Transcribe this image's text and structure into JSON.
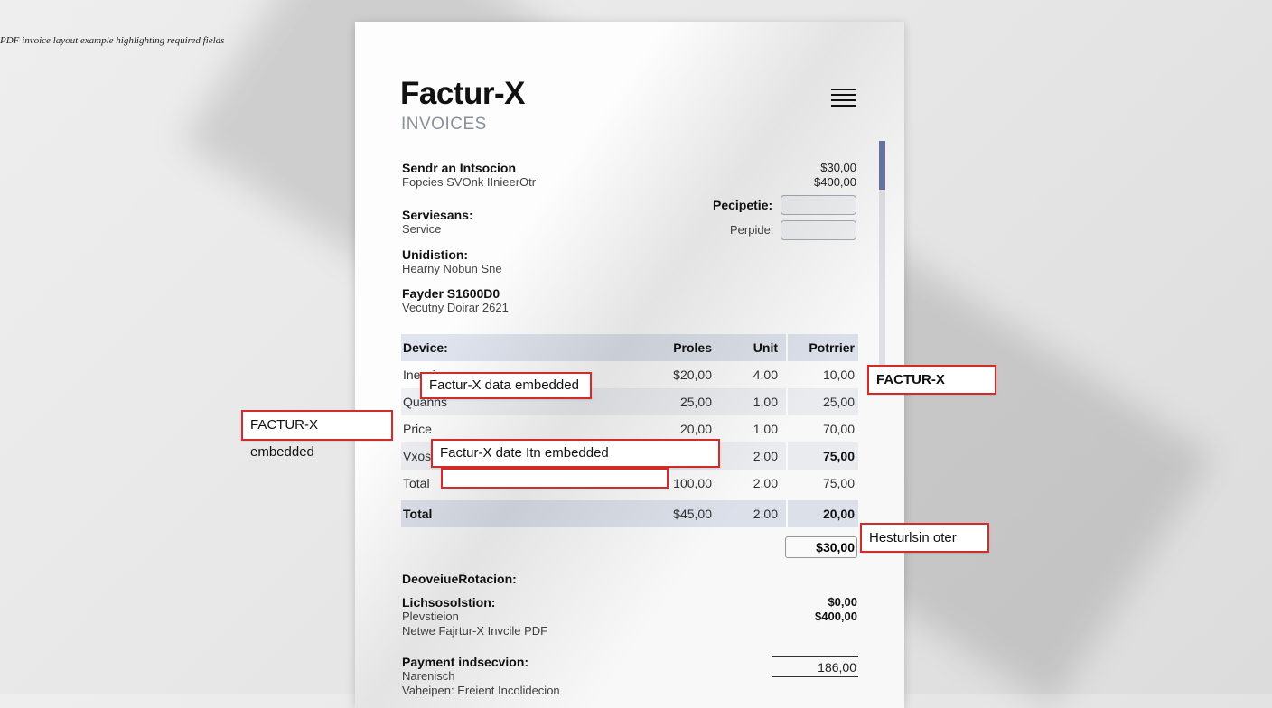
{
  "caption": "PDF invoice layout example highlighting required fields",
  "header": {
    "title": "Factur-X",
    "subtitle": "INVOICES",
    "menu_icon": "hamburger-menu-icon"
  },
  "sender": {
    "title": "Sendr an Intsocion",
    "line": "Fopcies SVOnk IInieerOtr"
  },
  "top_amounts": [
    "$30,00",
    "$400,00"
  ],
  "services": {
    "title": "Serviesans:",
    "line": "Service"
  },
  "distribution": {
    "title": "Unidistion:",
    "line": "Hearny Nobun Sne"
  },
  "payer": {
    "title": "Fayder S1600D0",
    "line": "Vecutny Doirar 2621"
  },
  "fields": {
    "recipient_label": "Pecipetie:",
    "perpide_label": "Perpide:"
  },
  "table": {
    "headers": [
      "Device:",
      "Proles",
      "Unit",
      "Potrrier"
    ],
    "rows": [
      [
        "Inerr ion",
        "$20,00",
        "4,00",
        "10,00"
      ],
      [
        "Quanns",
        "25,00",
        "1,00",
        "25,00"
      ],
      [
        "Price",
        "20,00",
        "1,00",
        "70,00"
      ],
      [
        "Vxos",
        "",
        "2,00",
        "75,00"
      ],
      [
        "Total",
        "100,00",
        "2,00",
        "75,00"
      ]
    ],
    "total": [
      "Total",
      "$45,00",
      "2,00",
      "20,00"
    ]
  },
  "grand_total": "$30,00",
  "footer": {
    "section_title": "DeoveiueRotacion:",
    "list_title": "Lichsosolstion:",
    "list_line1": "Plevstieion",
    "list_line2": "Netwe Fajrtur-X Invcile PDF",
    "amount1": "$0,00",
    "amount2": "$400,00",
    "payment_title": "Payment indsecvion:",
    "payment_line1": "Narenisch",
    "payment_line2": "Vaheipen: Ereient Incolidecion",
    "payment_amount": "186,00"
  },
  "callouts": {
    "factur_x_data_embedded": "Factur-X data embedded",
    "factur_x_embedded_left": "FACTUR-X embedded",
    "factur_x_right": "FACTUR-X",
    "factur_x_date_embedded": "Factur-X date Itn embedded",
    "empty_box": "",
    "heturlsin_oter": "Hesturlsin oter"
  },
  "colors": {
    "callout_border": "#d42a2a",
    "table_header": "#dfe4ee",
    "scroll_thumb": "#6b78a8"
  }
}
